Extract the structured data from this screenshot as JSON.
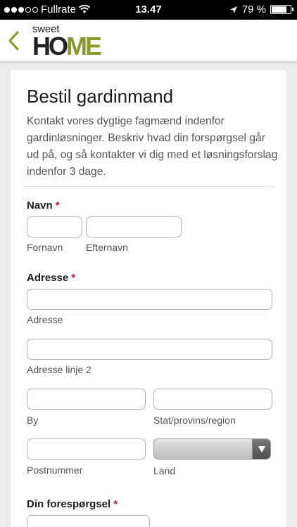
{
  "status_bar": {
    "carrier": "Fullrate",
    "time": "13.47",
    "battery": "79 %",
    "battery_level": 0.79
  },
  "header": {
    "logo_top": "sweet",
    "logo_main_part1": "HO",
    "logo_main_part2": "ME"
  },
  "form": {
    "title": "Bestil gardinmand",
    "intro": "Kontakt vores dygtige fagmænd indenfor gardinløsninger. Beskriv hvad din forspørgsel går ud på, og så kontakter vi dig med et løsningsforslag indenfor 3 dage.",
    "required_mark": "*",
    "name": {
      "label": "Navn",
      "first_label": "Fornavn",
      "last_label": "Efternavn",
      "first_value": "",
      "last_value": ""
    },
    "address": {
      "label": "Adresse",
      "line1_label": "Adresse",
      "line2_label": "Adresse linje 2",
      "city_label": "By",
      "state_label": "Stat/provins/region",
      "zip_label": "Postnummer",
      "country_label": "Land",
      "country_value": ""
    },
    "inquiry": {
      "label": "Din forespørgsel"
    }
  },
  "colors": {
    "accent_green": "#8a9a2a",
    "required_red": "#c8102e"
  }
}
